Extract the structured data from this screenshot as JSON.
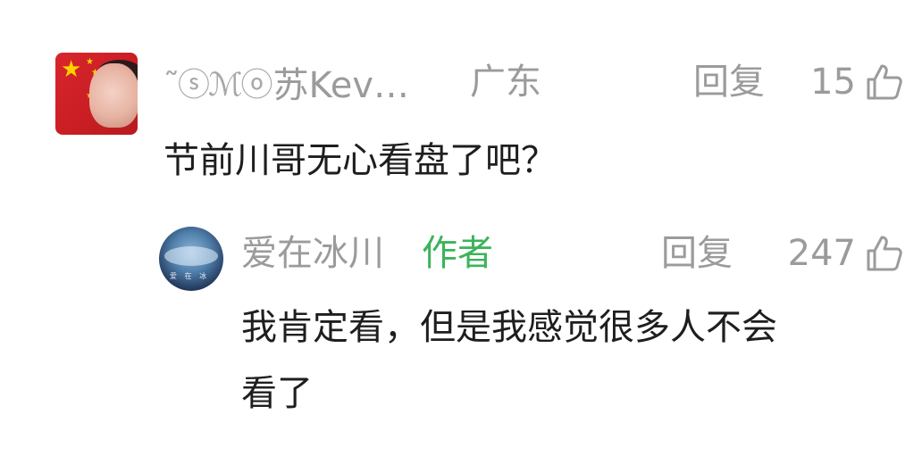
{
  "comment": {
    "username": "苏Kev…",
    "username_decoration": "˜ⓢℳⓞ",
    "location": "广东",
    "reply_label": "回复",
    "likes": "15",
    "text": "节前川哥无心看盘了吧？"
  },
  "reply": {
    "username": "爱在冰川",
    "author_badge": "作者",
    "reply_label": "回复",
    "likes": "247",
    "text_line1": "我肯定看，但是我感觉很多人不会",
    "text_line2": "看了",
    "avatar_text": "爱 在 冰"
  },
  "icons": {
    "like": "thumbs-up-icon"
  },
  "colors": {
    "meta_gray": "#9b9b9b",
    "text_dark": "#1e1e1e",
    "author_green": "#3cb35a"
  }
}
